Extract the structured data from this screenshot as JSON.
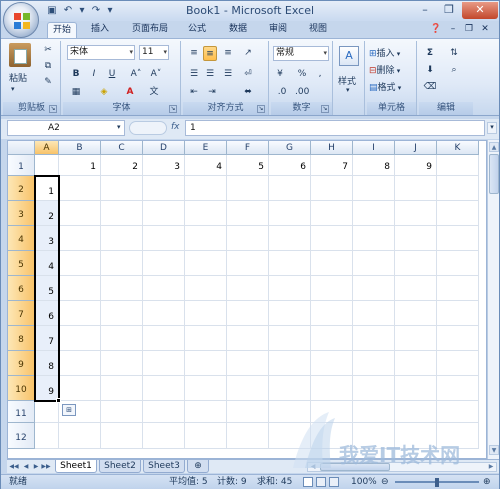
{
  "window": {
    "title": "Book1 - Microsoft Excel"
  },
  "tabs": [
    "开始",
    "插入",
    "页面布局",
    "公式",
    "数据",
    "审阅",
    "视图"
  ],
  "ribbon": {
    "clipboard": {
      "paste": "粘贴",
      "label": "剪贴板"
    },
    "font": {
      "name": "宋体",
      "size": "11",
      "label": "字体",
      "bold": "B",
      "italic": "I",
      "underline": "U"
    },
    "alignment": {
      "label": "对齐方式"
    },
    "number": {
      "format": "常规",
      "percent": "%",
      "comma": ",",
      "label": "数字"
    },
    "styles": {
      "button": "样式"
    },
    "cells": {
      "insert": "插入",
      "delete": "删除",
      "format": "格式",
      "label": "单元格"
    },
    "editing": {
      "sigma": "Σ",
      "label": "编辑"
    }
  },
  "formula": {
    "name_box": "A2",
    "fx": "fx",
    "content": "1"
  },
  "columns": [
    "A",
    "B",
    "C",
    "D",
    "E",
    "F",
    "G",
    "H",
    "I",
    "J",
    "K"
  ],
  "rows": [
    "1",
    "2",
    "3",
    "4",
    "5",
    "6",
    "7",
    "8",
    "9",
    "10",
    "11",
    "12"
  ],
  "cells": {
    "row1": [
      "",
      "1",
      "2",
      "3",
      "4",
      "5",
      "6",
      "7",
      "8",
      "9",
      ""
    ],
    "colA": [
      "1",
      "2",
      "3",
      "4",
      "5",
      "6",
      "7",
      "8",
      "9"
    ]
  },
  "sheets": [
    "Sheet1",
    "Sheet2",
    "Sheet3"
  ],
  "status": {
    "ready": "就绪",
    "average": "平均值: 5",
    "count": "计数: 9",
    "sum": "求和: 45",
    "zoom": "100%"
  },
  "watermark": {
    "text": "我爱IT技术网"
  },
  "colors": {
    "accent": "#f8c36a",
    "selection": "#e8effa",
    "ribbon": "#dfe9f7"
  }
}
